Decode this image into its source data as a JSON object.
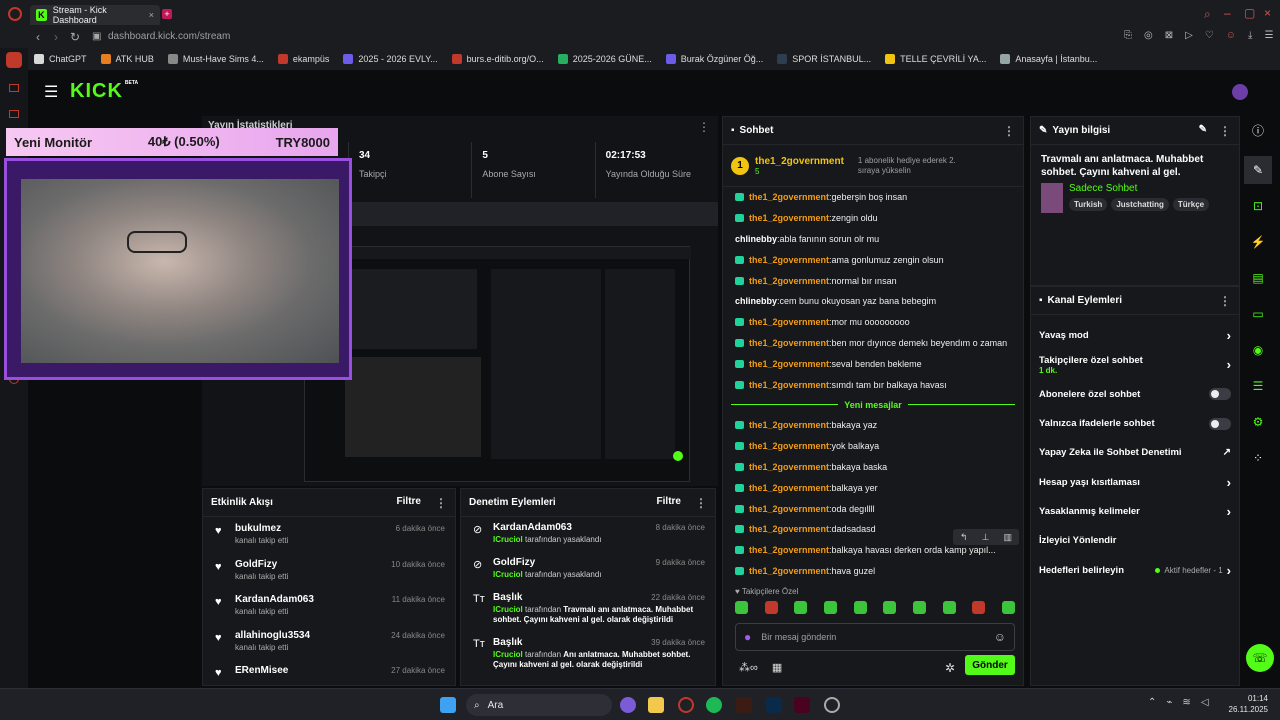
{
  "browser": {
    "tab_title": "Stream - Kick Dashboard",
    "url_domain": "dashboard.kick.com",
    "url_path": "/stream",
    "bookmarks": [
      {
        "label": "ChatGPT",
        "color": "#d9d9d9"
      },
      {
        "label": "ATK HUB",
        "color": "#e67e22"
      },
      {
        "label": "Must-Have Sims 4...",
        "color": "#888888"
      },
      {
        "label": "ekampüs",
        "color": "#c0392b"
      },
      {
        "label": "2025 - 2026 EVLY...",
        "color": "#6c5ce7"
      },
      {
        "label": "burs.e-ditib.org/O...",
        "color": "#c0392b"
      },
      {
        "label": "2025-2026 GÜNE...",
        "color": "#27ae60"
      },
      {
        "label": "Burak Özgüner Öğ...",
        "color": "#6c5ce7"
      },
      {
        "label": "SPOR İSTANBUL...",
        "color": "#2c3e50"
      },
      {
        "label": "TELLE ÇEVRİLİ YA...",
        "color": "#f1c40f"
      },
      {
        "label": "Anasayfa | İstanbu...",
        "color": "#95a5a6"
      }
    ]
  },
  "header": {
    "logo": "KICK",
    "logo_tag": "BETA"
  },
  "overlay": {
    "title": "Yeni Monitör",
    "amount": "40₺ (0.50%)",
    "goal": "TRY8000"
  },
  "stats": {
    "header": "Yayın İstatistikleri",
    "items": [
      {
        "value": "34",
        "label": "Takipçi"
      },
      {
        "value": "5",
        "label": "Abone Sayısı"
      },
      {
        "value": "02:17:53",
        "label": "Yayında Olduğu Süre"
      }
    ]
  },
  "activity": {
    "title": "Etkinlik Akışı",
    "filter": "Filtre",
    "items": [
      {
        "user": "bukulmez",
        "action": "kanalı takip etti",
        "time": "6 dakika önce"
      },
      {
        "user": "GoldFizy",
        "action": "kanalı takip etti",
        "time": "10 dakika önce"
      },
      {
        "user": "KardanAdam063",
        "action": "kanalı takip etti",
        "time": "11 dakika önce"
      },
      {
        "user": "allahinoglu3534",
        "action": "kanalı takip etti",
        "time": "24 dakika önce"
      },
      {
        "user": "ERenMisee",
        "action": "",
        "time": "27 dakika önce"
      }
    ]
  },
  "moderation": {
    "title": "Denetim Eylemleri",
    "filter": "Filtre",
    "items": [
      {
        "title": "KardanAdam063",
        "mod": "ICruciol",
        "text": "tarafından yasaklandı",
        "extra": "",
        "time": "8 dakika önce"
      },
      {
        "title": "GoldFizy",
        "mod": "ICruciol",
        "text": "tarafından yasaklandı",
        "extra": "",
        "time": "9 dakika önce"
      },
      {
        "title": "Başlık",
        "mod": "ICruciol",
        "text": "tarafından",
        "extra": "Travmalı anı anlatmaca. Muhabbet sohbet. Çayını kahveni al gel. olarak değiştirildi",
        "time": "22 dakika önce"
      },
      {
        "title": "Başlık",
        "mod": "ICruciol",
        "text": "tarafından",
        "extra": "Anı anlatmaca. Muhabbet sohbet. Çayını kahveni al gel. olarak değiştirildi",
        "time": "39 dakika önce"
      }
    ]
  },
  "chat": {
    "title": "Sohbet",
    "pinned_user": "the1_2government",
    "pinned_count": "5",
    "pinned_note": "1 abonelik hediye ederek 2. sıraya yükselin",
    "messages_top": [
      {
        "user": "the1_2government",
        "text": "geberşin boş insan",
        "badge": true
      },
      {
        "user": "the1_2government",
        "text": "zengin oldu",
        "badge": true
      },
      {
        "user": "chlinebby",
        "text": "abla fanının sorun olr mu",
        "badge": false
      },
      {
        "user": "the1_2government",
        "text": "ama gonlumuz zengin olsun",
        "badge": true
      },
      {
        "user": "the1_2government",
        "text": "normal bır ınsan",
        "badge": true
      },
      {
        "user": "chlinebby",
        "text": "cem bunu okuyosan yaz bana bebegim",
        "badge": false
      },
      {
        "user": "the1_2government",
        "text": "mor mu ooooooooo",
        "badge": true
      },
      {
        "user": "the1_2government",
        "text": "ben mor dıyınce demekı beyendım o zaman",
        "badge": true
      },
      {
        "user": "the1_2government",
        "text": "seval benden bekleme",
        "badge": true
      },
      {
        "user": "the1_2government",
        "text": "sımdı tam bır balkaya havası",
        "badge": true
      }
    ],
    "new_divider": "Yeni mesajlar",
    "messages_new": [
      {
        "user": "the1_2government",
        "text": "bakaya yaz"
      },
      {
        "user": "the1_2government",
        "text": "yok balkaya"
      },
      {
        "user": "the1_2government",
        "text": "bakaya baska"
      },
      {
        "user": "the1_2government",
        "text": "balkaya yer"
      },
      {
        "user": "the1_2government",
        "text": "oda degıllll"
      },
      {
        "user": "the1_2government",
        "text": "dadsadasd"
      },
      {
        "user": "the1_2government",
        "text": "balkaya havası derken orda kamp yapıl..."
      },
      {
        "user": "the1_2government",
        "text": "hava guzel"
      }
    ],
    "emote_section": "Takipçilere Özel",
    "input_placeholder": "Bir mesaj gönderin",
    "send": "Gönder"
  },
  "stream_info": {
    "title": "Yayın bilgisi",
    "text": "Travmalı anı anlatmaca. Muhabbet sohbet. Çayını kahveni al gel.",
    "category": "Sadece Sohbet",
    "tags": [
      "Turkish",
      "Justchatting",
      "Türkçe"
    ]
  },
  "channel_actions": {
    "title": "Kanal Eylemleri",
    "items": [
      {
        "label": "Yavaş mod",
        "sub": "",
        "control": "chevron"
      },
      {
        "label": "Takipçilere özel sohbet",
        "sub": "1 dk.",
        "control": "chevron"
      },
      {
        "label": "Abonelere özel sohbet",
        "sub": "",
        "control": "toggle"
      },
      {
        "label": "Yalnızca ifadelerle sohbet",
        "sub": "",
        "control": "toggle"
      },
      {
        "label": "Yapay Zeka ile Sohbet Denetimi",
        "sub": "",
        "control": "external"
      },
      {
        "label": "Hesap yaşı kısıtlaması",
        "sub": "",
        "control": "chevron"
      },
      {
        "label": "Yasaklanmış kelimeler",
        "sub": "",
        "control": "chevron"
      },
      {
        "label": "İzleyici Yönlendir",
        "sub": "",
        "control": "none"
      },
      {
        "label": "Hedefleri belirleyin",
        "sub": "Aktif hedefler - 1",
        "control": "chevron"
      }
    ]
  },
  "taskbar": {
    "search": "Ara",
    "time": "01:14",
    "date": "26.11.2025"
  }
}
